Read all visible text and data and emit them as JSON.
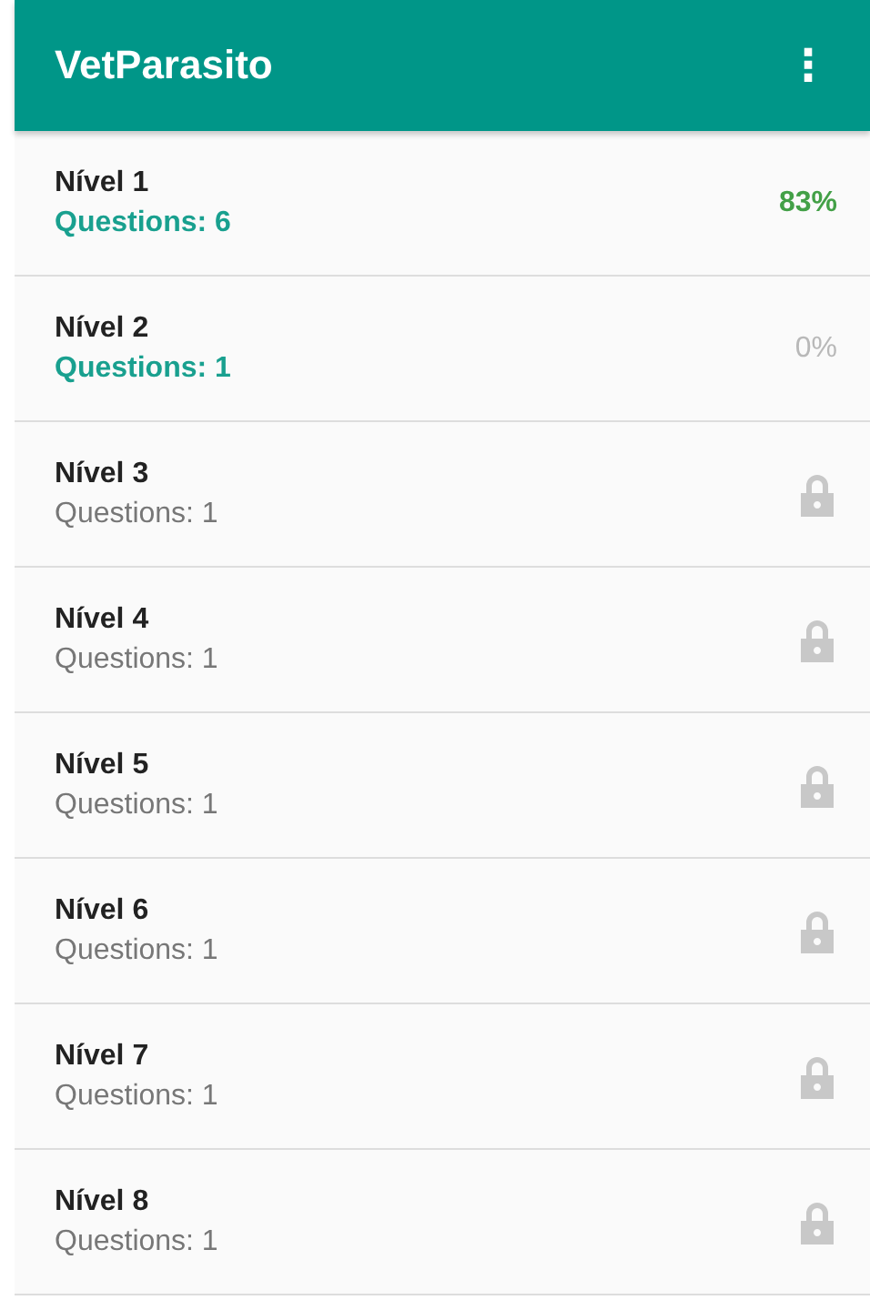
{
  "app_bar": {
    "title": "VetParasito",
    "menu_icon": "⋮"
  },
  "levels": [
    {
      "name": "Nível 1",
      "questions": "Questions: 6",
      "locked": false,
      "started": true,
      "progress": "83%"
    },
    {
      "name": "Nível 2",
      "questions": "Questions: 1",
      "locked": false,
      "started": false,
      "progress": "0%"
    },
    {
      "name": "Nível 3",
      "questions": "Questions: 1",
      "locked": true
    },
    {
      "name": "Nível 4",
      "questions": "Questions: 1",
      "locked": true
    },
    {
      "name": "Nível 5",
      "questions": "Questions: 1",
      "locked": true
    },
    {
      "name": "Nível 6",
      "questions": "Questions: 1",
      "locked": true
    },
    {
      "name": "Nível 7",
      "questions": "Questions: 1",
      "locked": true
    },
    {
      "name": "Nível 8",
      "questions": "Questions: 1",
      "locked": true
    }
  ]
}
